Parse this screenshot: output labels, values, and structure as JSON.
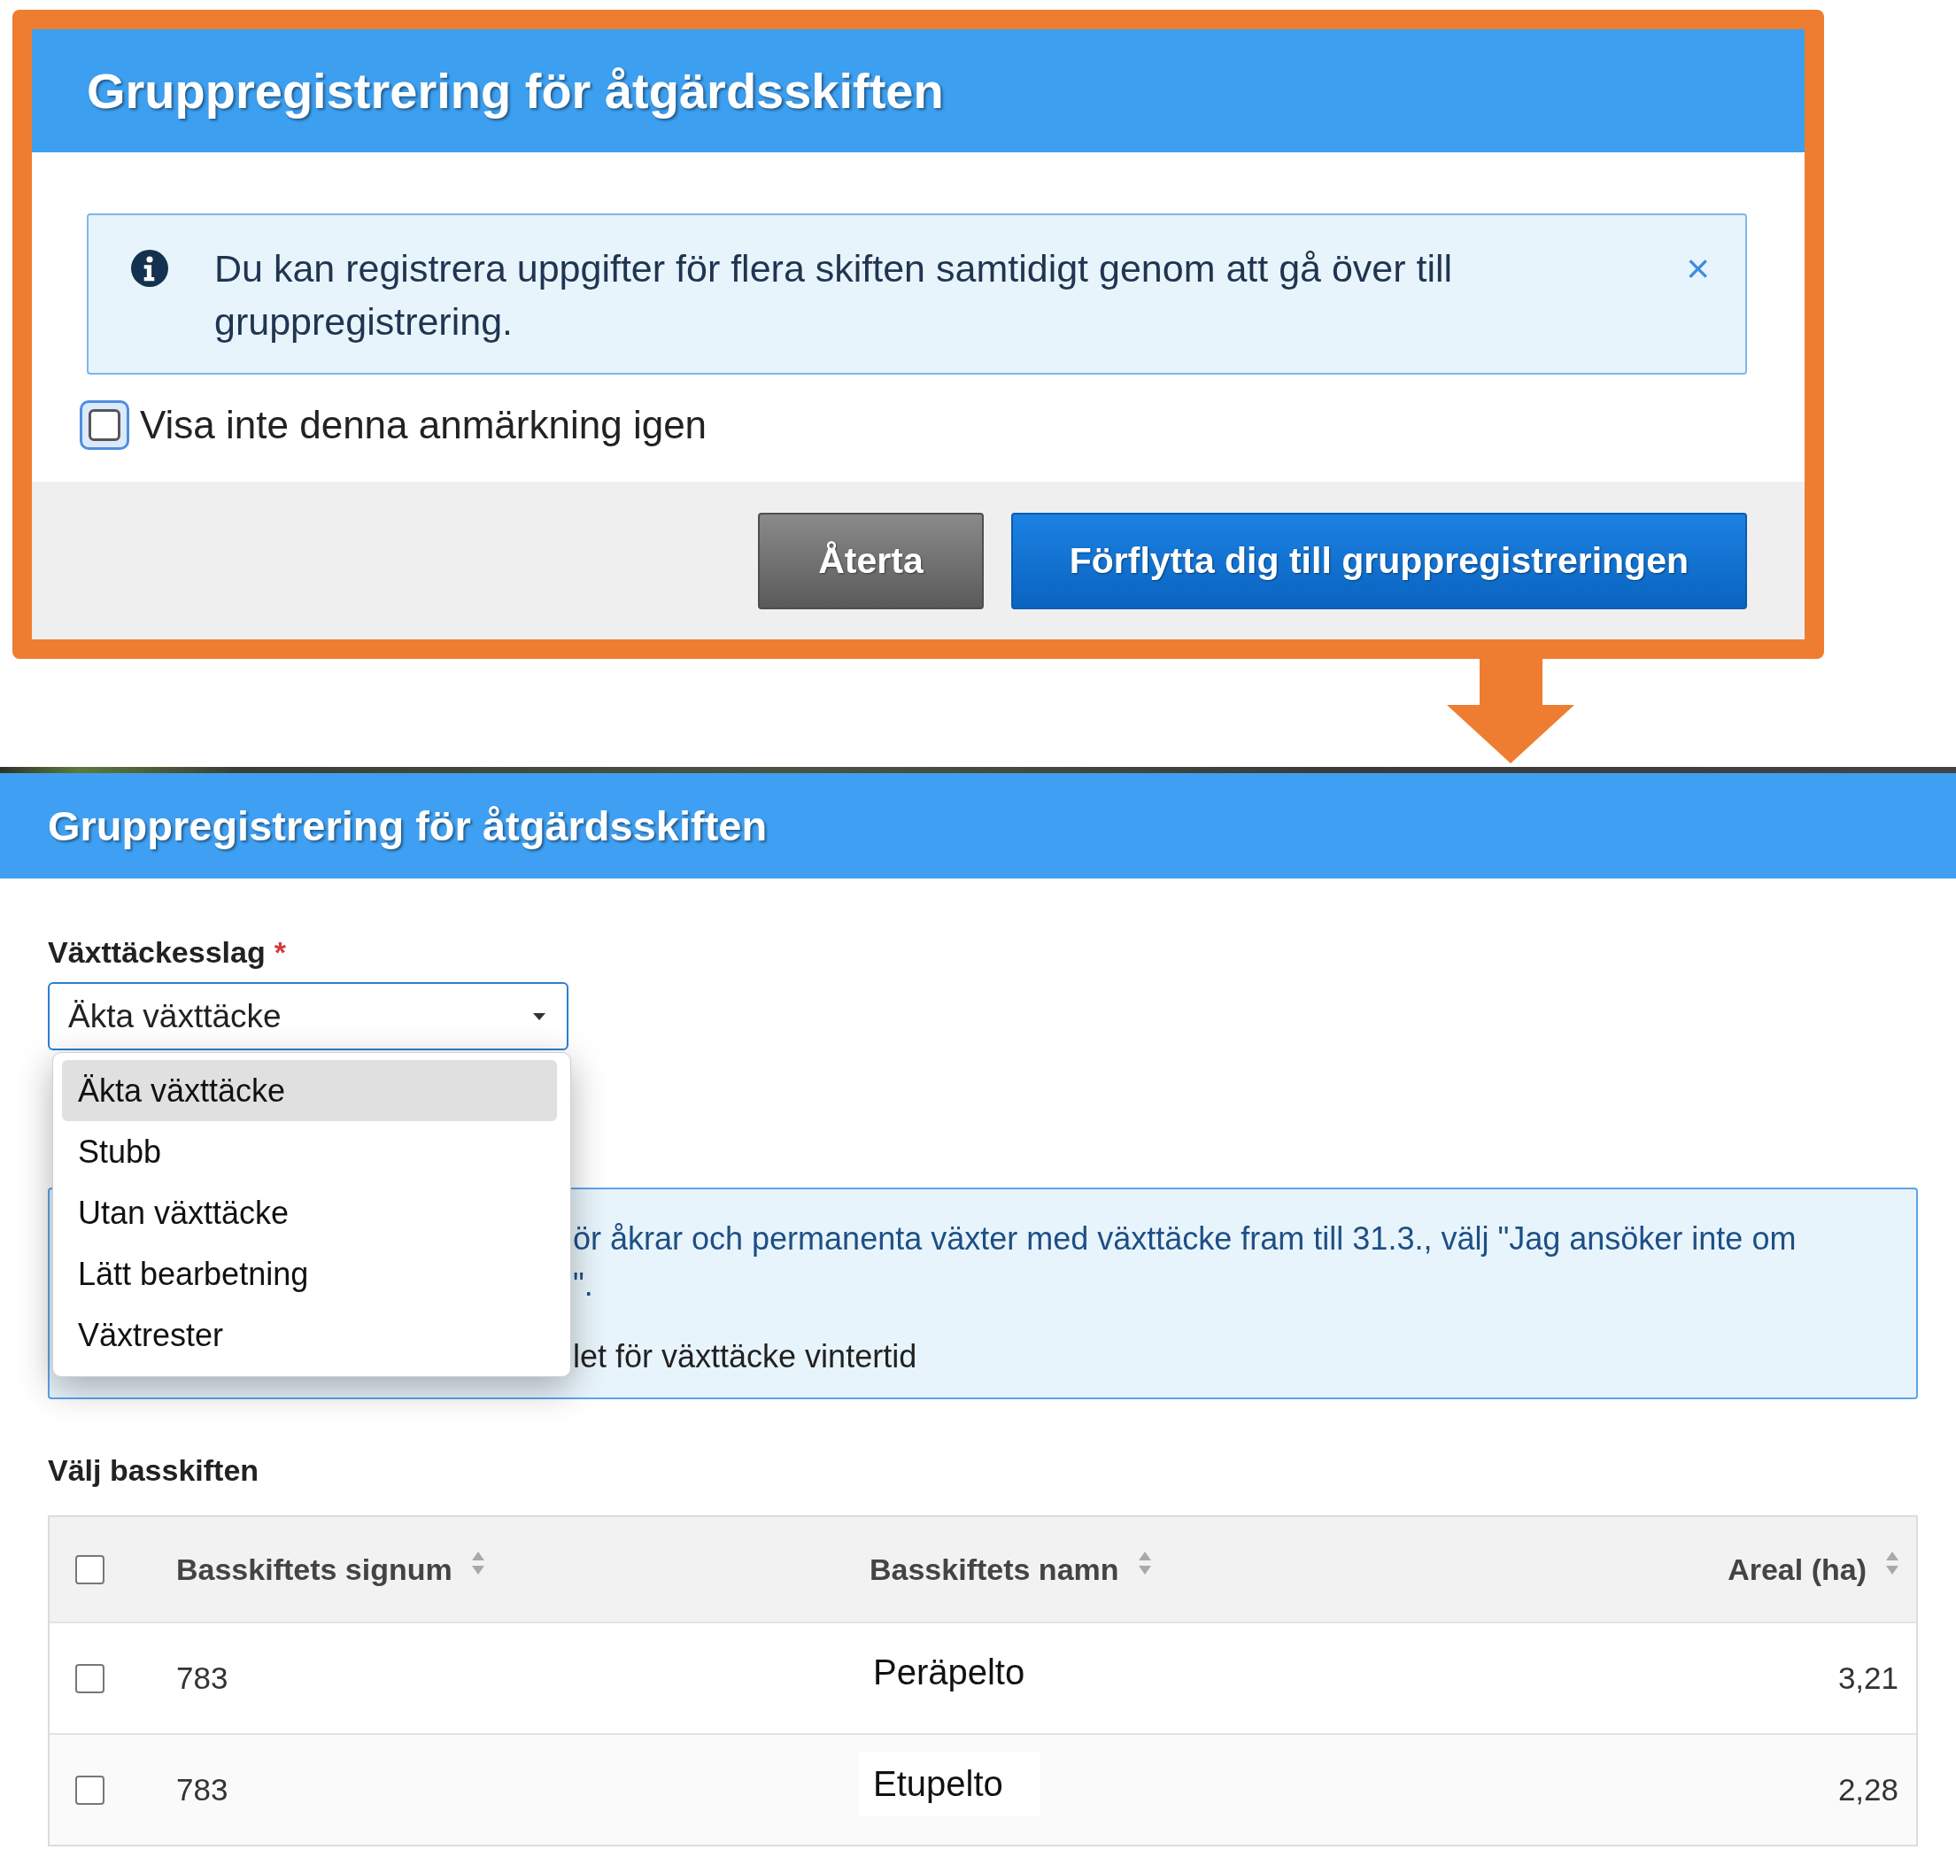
{
  "dialog": {
    "title": "Gruppregistrering för åtgärdsskiften",
    "notice": {
      "text": "Du kan registrera uppgifter för flera skiften samtidigt genom att gå över till gruppregistrering.",
      "close": "×"
    },
    "checkbox": {
      "label": "Visa inte denna anmärkning igen",
      "checked": false,
      "focused": true
    },
    "buttons": [
      {
        "label": "Återta",
        "kind": "secondary"
      },
      {
        "label": "Förflytta dig till gruppregistreringen",
        "kind": "primary"
      }
    ]
  },
  "page": {
    "title": "Gruppregistrering för åtgärdsskiften",
    "field": {
      "label": "Växttäckesslag",
      "required_mark": "*",
      "value": "Äkta växttäcke",
      "expanded": true,
      "options": [
        {
          "label": "Äkta växttäcke",
          "selected": true
        },
        {
          "label": "Stubb",
          "selected": false
        },
        {
          "label": "Utan växttäcke",
          "selected": false
        },
        {
          "label": "Lätt bearbetning",
          "selected": false
        },
        {
          "label": "Växtrester",
          "selected": false
        }
      ]
    },
    "notice": {
      "lines": [
        "ör åkrar och permanenta växter med växttäcke fram till 31.3., välj \"Jag ansöker inte om",
        "\"."
      ],
      "note": "let för växttäcke vintertid"
    },
    "table": {
      "title": "Välj basskiften",
      "all_checked": false,
      "columns": [
        {
          "label": "Basskiftets signum",
          "kind": "text"
        },
        {
          "label": "Basskiftets namn",
          "kind": "text"
        },
        {
          "label": "Areal (ha)",
          "kind": "number"
        }
      ],
      "rows": [
        {
          "checked": false,
          "cells": [
            "783",
            "Peräpelto",
            "3,21"
          ]
        },
        {
          "checked": false,
          "cells": [
            "783",
            "Etupelto",
            "2,28"
          ]
        }
      ]
    }
  }
}
